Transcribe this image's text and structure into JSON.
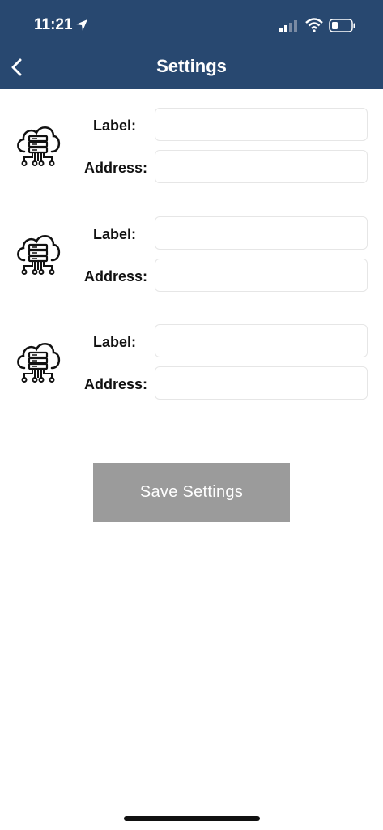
{
  "status": {
    "time": "11:21"
  },
  "header": {
    "title": "Settings"
  },
  "servers": [
    {
      "label_caption": "Label:",
      "address_caption": "Address:",
      "label_value": "",
      "address_value": ""
    },
    {
      "label_caption": "Label:",
      "address_caption": "Address:",
      "label_value": "",
      "address_value": ""
    },
    {
      "label_caption": "Label:",
      "address_caption": "Address:",
      "label_value": "",
      "address_value": ""
    }
  ],
  "actions": {
    "save_label": "Save Settings"
  },
  "colors": {
    "header": "#284870",
    "save_button": "#9b9b9b",
    "background": "#ffffff"
  },
  "icons": [
    "back-icon",
    "location-arrow-icon",
    "cellular-signal-icon",
    "wifi-icon",
    "battery-icon",
    "cloud-server-icon"
  ]
}
